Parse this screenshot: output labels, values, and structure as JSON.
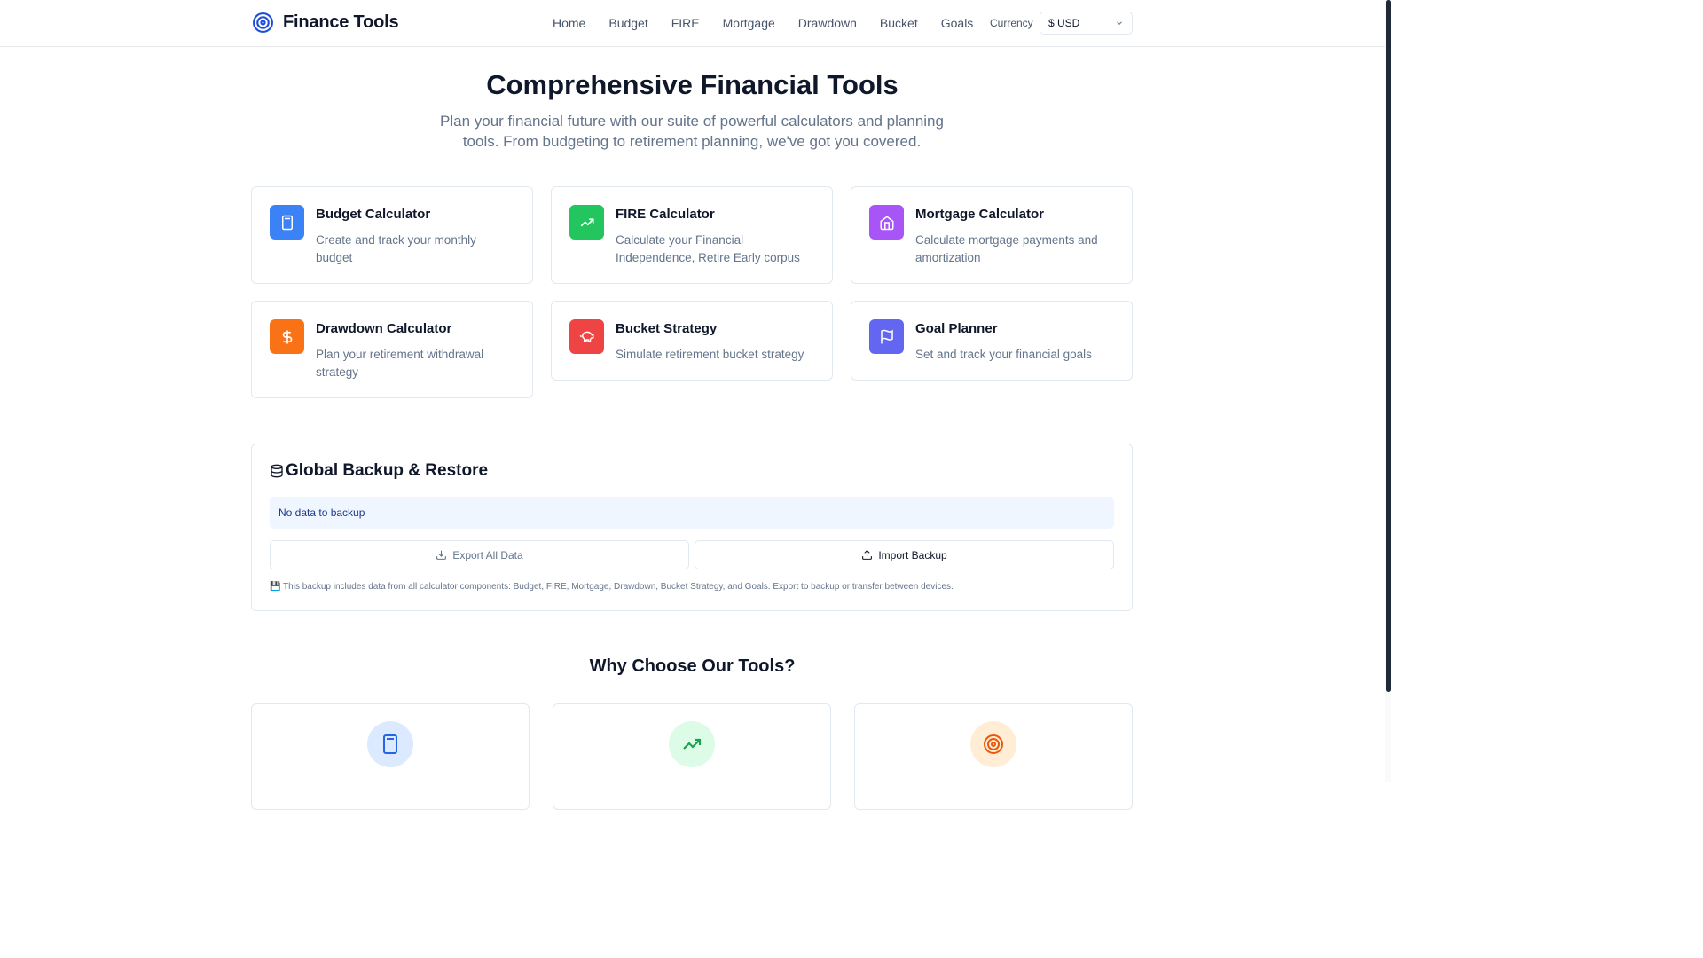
{
  "header": {
    "brand": "Finance Tools",
    "nav": [
      "Home",
      "Budget",
      "FIRE",
      "Mortgage",
      "Drawdown",
      "Bucket",
      "Goals"
    ],
    "currency_label": "Currency",
    "currency_value": "$ USD"
  },
  "hero": {
    "title": "Comprehensive Financial Tools",
    "subtitle": "Plan your financial future with our suite of powerful calculators and planning tools. From budgeting to retirement planning, we've got you covered."
  },
  "tools": [
    {
      "title": "Budget Calculator",
      "desc": "Create and track your monthly budget",
      "icon": "calculator-icon",
      "color": "#3b82f6"
    },
    {
      "title": "FIRE Calculator",
      "desc": "Calculate your Financial Independence, Retire Early corpus",
      "icon": "trending-up-icon",
      "color": "#22c55e"
    },
    {
      "title": "Mortgage Calculator",
      "desc": "Calculate mortgage payments and amortization",
      "icon": "home-icon",
      "color": "#a855f7"
    },
    {
      "title": "Drawdown Calculator",
      "desc": "Plan your retirement withdrawal strategy",
      "icon": "dollar-icon",
      "color": "#f97316"
    },
    {
      "title": "Bucket Strategy",
      "desc": "Simulate retirement bucket strategy",
      "icon": "piggy-bank-icon",
      "color": "#ef4444"
    },
    {
      "title": "Goal Planner",
      "desc": "Set and track your financial goals",
      "icon": "flag-icon",
      "color": "#6366f1"
    }
  ],
  "backup": {
    "title": "Global Backup & Restore",
    "status": "No data to backup",
    "export_label": "Export All Data",
    "import_label": "Import Backup",
    "note": "💾 This backup includes data from all calculator components: Budget, FIRE, Mortgage, Drawdown, Bucket Strategy, and Goals. Export to backup or transfer between devices."
  },
  "why": {
    "title": "Why Choose Our Tools?"
  },
  "colors": {
    "feature_blue_bg": "#dbeafe",
    "feature_green_bg": "#dcfce7",
    "feature_orange_bg": "#ffedd5"
  }
}
